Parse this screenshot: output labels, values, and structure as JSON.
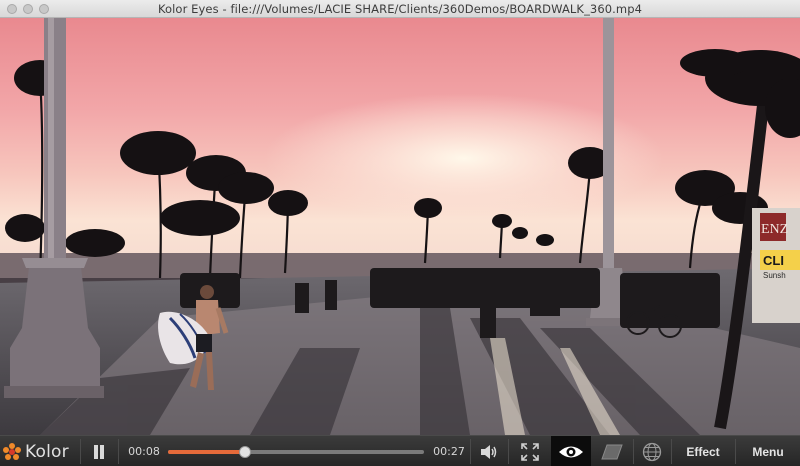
{
  "window": {
    "title": "Kolor Eyes - file:///Volumes/LACIE SHARE/Clients/360Demos/BOARDWALK_360.mp4"
  },
  "video": {
    "scene": "Venice Beach boardwalk at sunset, 360° video frame",
    "storefront_sign": "CLI",
    "storefront_subsign": "Sunsh",
    "banner_sign": "ENZ"
  },
  "player": {
    "brand": "Kolor",
    "current_time": "00:08",
    "total_time": "00:27",
    "progress_fraction": 0.3,
    "accent_color": "#e56a3a",
    "buttons": {
      "play_pause_icon": "pause-icon",
      "volume_icon": "speaker-icon",
      "fullscreen_icon": "expand-arrows-icon",
      "view_mode_icon": "eye-icon",
      "flat_view_icon": "flat-plane-icon",
      "globe_icon": "globe-icon",
      "effect_label": "Effect",
      "menu_label": "Menu"
    }
  }
}
